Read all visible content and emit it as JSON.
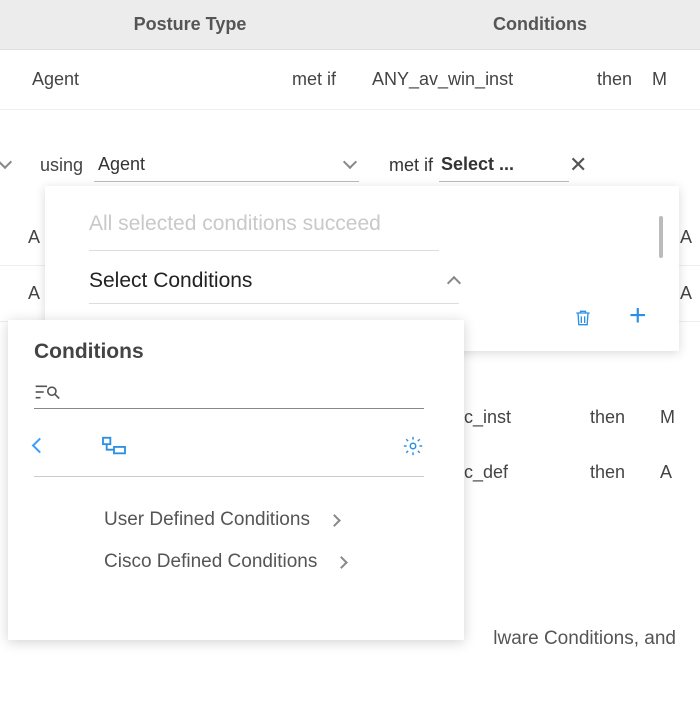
{
  "header": {
    "col1": "Posture Type",
    "col2": "Conditions"
  },
  "rows": [
    {
      "posture": "Agent",
      "metif": "met if",
      "cond": "ANY_av_win_inst",
      "then": "then",
      "trail": "M"
    }
  ],
  "editRow": {
    "using": "using",
    "agent": "Agent",
    "metif": "met if",
    "condPlaceholder": "Select ..."
  },
  "panel1": {
    "allSucceed": "All selected conditions succeed",
    "selectConditions": "Select Conditions"
  },
  "panel2": {
    "title": "Conditions",
    "items": [
      "User Defined Conditions",
      "Cisco Defined Conditions"
    ]
  },
  "bgRows": {
    "r2": {
      "posture": "A",
      "trail": "A"
    },
    "r3": {
      "posture": "A",
      "trail": "A"
    }
  },
  "hiddenRows": [
    {
      "cond": "v_mac_inst",
      "then": "then",
      "trail": "M"
    },
    {
      "cond": "v_mac_def",
      "then": "then",
      "trail": "A"
    }
  ],
  "footer": "lware Conditions, and"
}
